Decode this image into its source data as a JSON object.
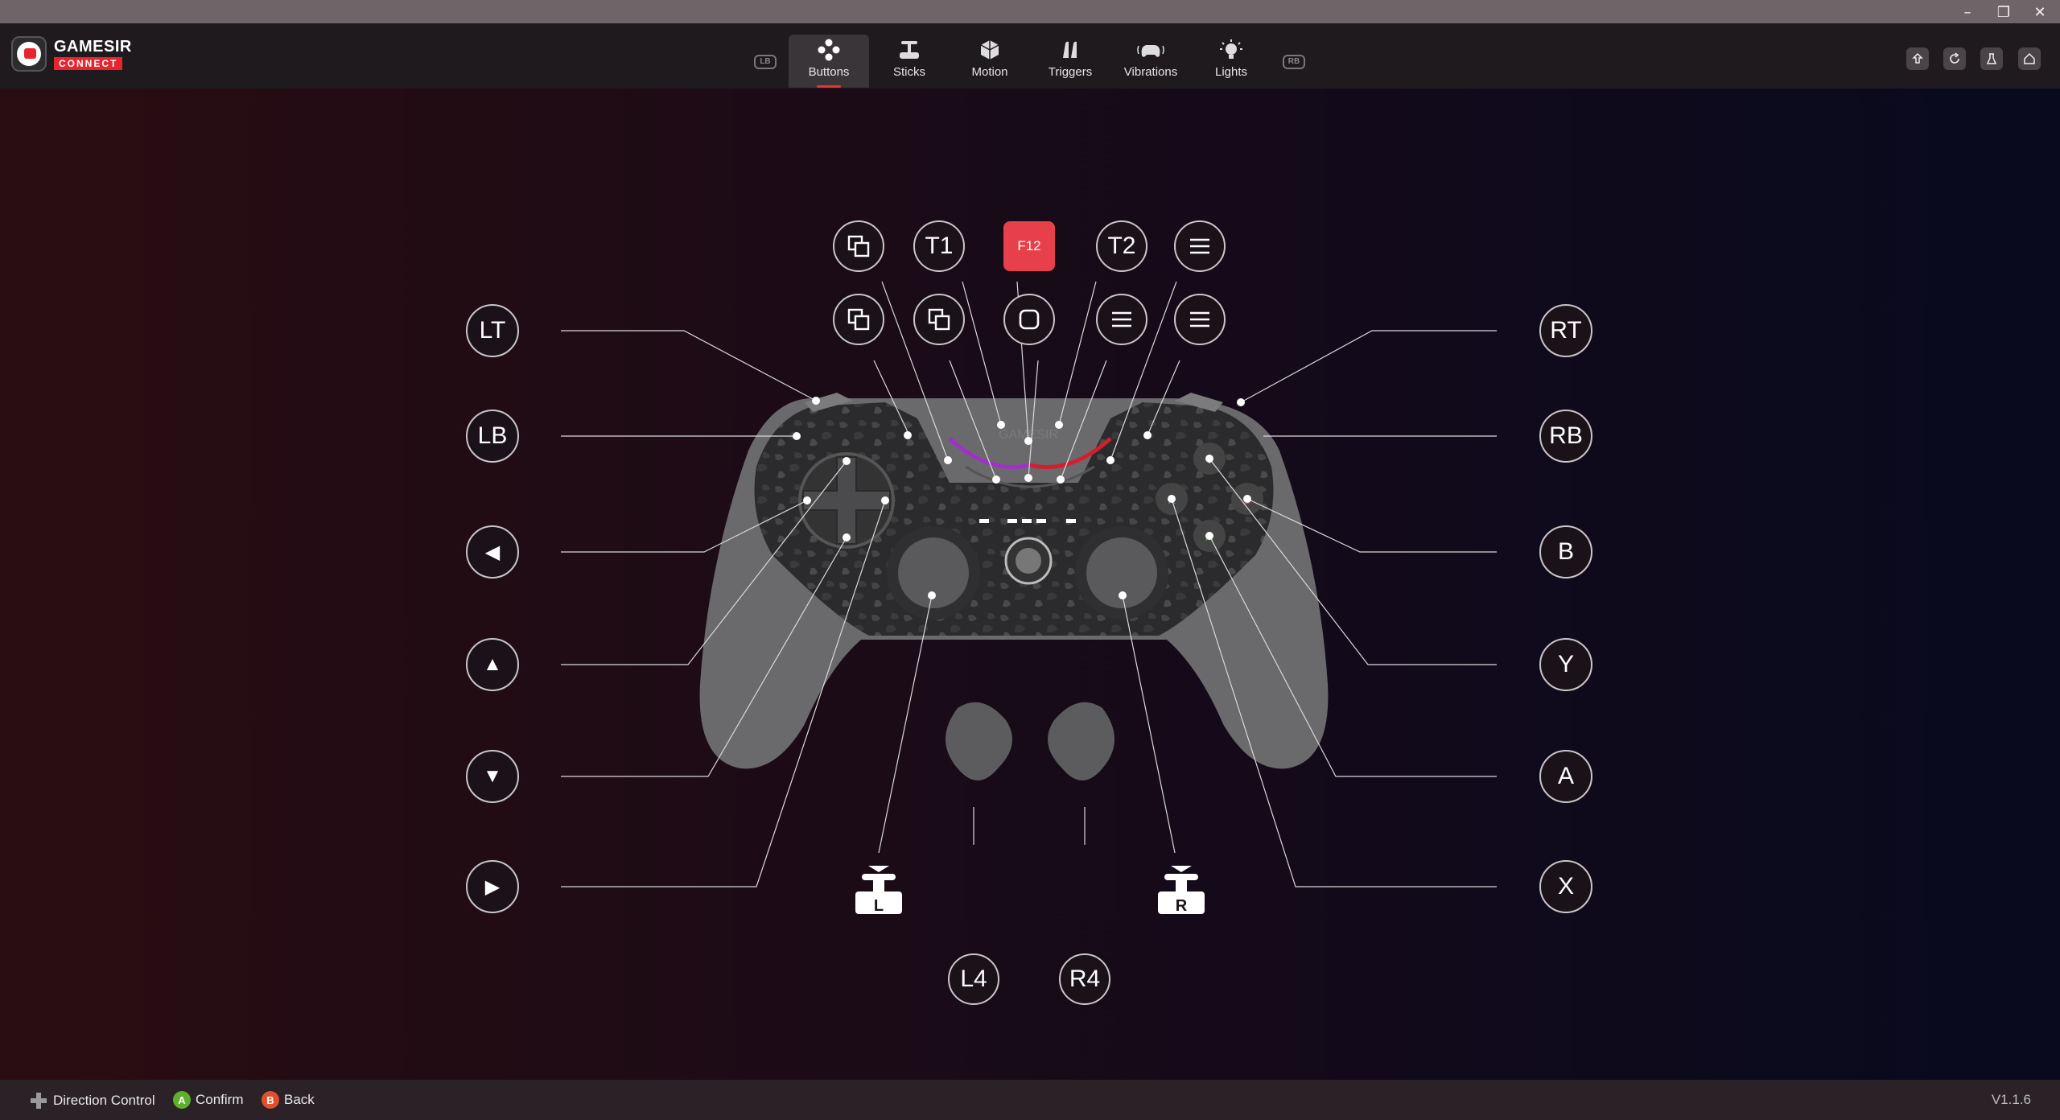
{
  "app": {
    "logo_text": "GAMESIR",
    "logo_sub": "CONNECT",
    "version": "V1.1.6"
  },
  "window_controls": [
    "minimize",
    "restore",
    "close"
  ],
  "tabs": [
    {
      "label": "Buttons",
      "icon": "buttons-icon",
      "active": true
    },
    {
      "label": "Sticks",
      "icon": "sticks-icon",
      "active": false
    },
    {
      "label": "Motion",
      "icon": "motion-icon",
      "active": false
    },
    {
      "label": "Triggers",
      "icon": "triggers-icon",
      "active": false
    },
    {
      "label": "Vibrations",
      "icon": "vibrations-icon",
      "active": false
    },
    {
      "label": "Lights",
      "icon": "lights-icon",
      "active": false
    }
  ],
  "bumpers": {
    "left": "LB",
    "right": "RB"
  },
  "header_actions": [
    "upload-icon",
    "reset-icon",
    "test-icon",
    "home-icon"
  ],
  "mapping": {
    "left": [
      "LT",
      "LB",
      "◀",
      "▲",
      "▼",
      "▶"
    ],
    "right": [
      "RT",
      "RB",
      "B",
      "Y",
      "A",
      "X"
    ],
    "top_row": [
      "view-icon",
      "T1",
      "F12",
      "T2",
      "menu-icon"
    ],
    "second_row": [
      "view-icon",
      "view-icon",
      "capture-icon",
      "menu-icon",
      "menu-icon"
    ],
    "bottom": [
      "L",
      "L4",
      "R4",
      "R"
    ]
  },
  "controller": {
    "brand": "GAMESIR"
  },
  "footer": {
    "direction": "Direction Control",
    "confirm_badge": "A",
    "confirm": "Confirm",
    "back_badge": "B",
    "back": "Back"
  },
  "colors": {
    "accent": "#e8352f",
    "active_key": "#e8404a",
    "confirm_badge": "#5fae2e",
    "back_badge": "#e0502c"
  }
}
